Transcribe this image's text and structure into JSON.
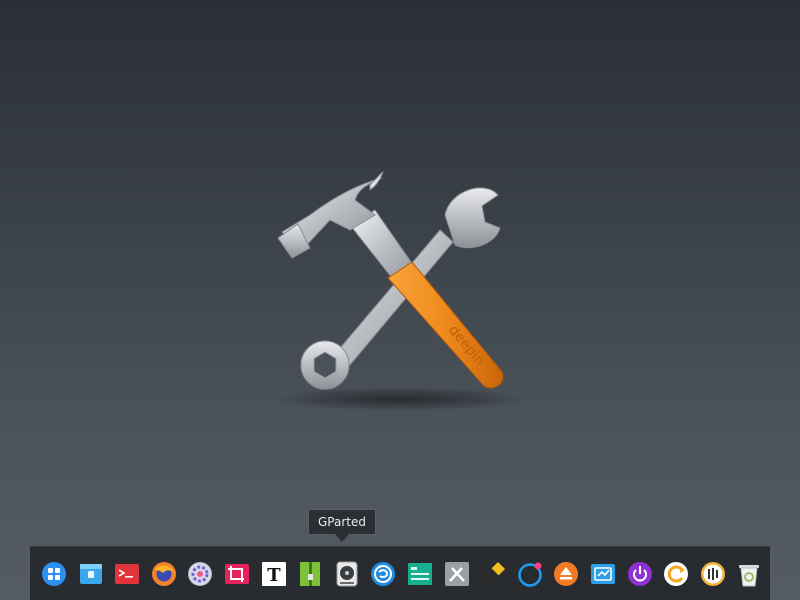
{
  "wallpaper": {
    "logo_icon": "hammer-wrench-icon",
    "handle_text": "deepin",
    "colors": {
      "handle": "#f08a1c",
      "metal": "#c9ccd0"
    }
  },
  "tooltip": {
    "text": "GParted"
  },
  "dock": {
    "items": [
      {
        "name": "launcher-icon",
        "color": "#2d8ff0"
      },
      {
        "name": "file-manager-icon",
        "color": "#3aa7e8"
      },
      {
        "name": "terminal-icon",
        "color": "#e2353b"
      },
      {
        "name": "firefox-icon",
        "color": "#f3822a"
      },
      {
        "name": "settings-icon",
        "color": "#d9dbe8"
      },
      {
        "name": "screenshot-icon",
        "color": "#e8225e"
      },
      {
        "name": "text-editor-icon",
        "color": "#ffffff",
        "glyph": "T"
      },
      {
        "name": "archive-manager-icon",
        "color": "#7cc23a"
      },
      {
        "name": "gparted-icon",
        "color": "#e9e9e9"
      },
      {
        "name": "deepin-store-icon",
        "color": "#1e8be0"
      },
      {
        "name": "system-monitor-icon",
        "color": "#16b08e"
      },
      {
        "name": "development-tools-icon",
        "color": "#9aa0a6"
      },
      {
        "name": "usb-writer-icon",
        "color": "#f0c020"
      },
      {
        "name": "music-player-icon",
        "color": "#1d9ef2"
      },
      {
        "name": "eject-icon",
        "color": "#f47b26"
      },
      {
        "name": "screen-capture-icon",
        "color": "#2c9fe6"
      },
      {
        "name": "power-icon",
        "color": "#8e32d6"
      },
      {
        "name": "update-icon",
        "color": "#f5a623"
      },
      {
        "name": "equalizer-icon",
        "color": "#f3b23b"
      },
      {
        "name": "trash-icon",
        "color": "#9ac26a"
      }
    ]
  }
}
